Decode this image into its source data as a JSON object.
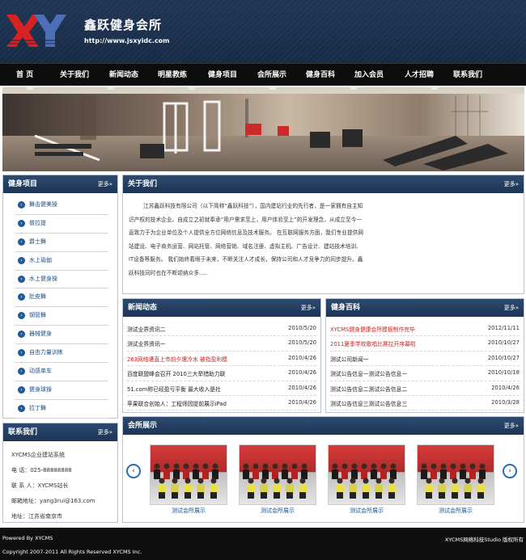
{
  "header": {
    "logo_text": "XY",
    "site_name": "鑫跃健身会所",
    "site_url": "http://www.jsxyidc.com"
  },
  "nav": [
    "首 页",
    "关于我们",
    "新闻动态",
    "明星教练",
    "健身项目",
    "会所展示",
    "健身百科",
    "加入会员",
    "人才招聘",
    "联系我们"
  ],
  "more_label": "更多",
  "projects": {
    "title": "健身项目",
    "items": [
      "舞击健美操",
      "普拉提",
      "爵士舞",
      "水上瑜伽",
      "水上健身操",
      "肚皮舞",
      "钢管舞",
      "器械健身",
      "自由力量训练",
      "动感单车",
      "健身球操",
      "拉丁舞"
    ]
  },
  "contact": {
    "title": "联系我们",
    "lines": [
      "XYCMS企业建站系统",
      "电 话：025-88888888",
      "联 系 人：XYCMS站长",
      "邮箱地址：yang3rui@163.com",
      "地址：江苏省南京市"
    ]
  },
  "about": {
    "title": "关于我们",
    "text": "江苏鑫跃科技有限公司（以下简称“鑫跃科技”），国内建站行业的先行者，是一家拥有自主知识产权的技术企业。自成立之初就奉承“用户需求至上，用户体验至上”的开发理念，从成立至今一直致力于为企业单位及个人提供全方位网络信息及技术服务。 在互联网服务方面，我们专业提供网站建设、电子商务运营、网站托管、网络营销、域名注册、虚拟主机、广告设计、建站技术培训、IT设备等服务。 我们始终着眼于未来，不断关注人才成长，保持公司和人才竞争力的同步提升。鑫跃科技同时也在不断颂纳众多....."
  },
  "news": {
    "title": "新闻动态",
    "items": [
      {
        "title": "测试业界资讯二",
        "date": "2010/5/20",
        "highlight": false
      },
      {
        "title": "测试业界资讯一",
        "date": "2010/5/20",
        "highlight": false
      },
      {
        "title": "263网络遭直上市前夕遭冷水 被指盈利模",
        "date": "2010/4/26",
        "highlight": true
      },
      {
        "title": "百度联盟峰会召开 2010三大举措助力联",
        "date": "2010/4/26",
        "highlight": false
      },
      {
        "title": "51.com称已经盈亏平衡 最大收入是社",
        "date": "2010/4/26",
        "highlight": false
      },
      {
        "title": "苹果联合创始人：工程师因提前展示iPad",
        "date": "2010/4/26",
        "highlight": false
      }
    ]
  },
  "wiki": {
    "title": "健身百科",
    "items": [
      {
        "title": "XYCMS健身健康会所模板制作完毕",
        "date": "2012/11/11",
        "highlight": true
      },
      {
        "title": "2011夏季学校歌唱比赛拉开序幕啦",
        "date": "2010/10/27",
        "highlight": true
      },
      {
        "title": "测试公司新闻一",
        "date": "2010/10/27",
        "highlight": false
      },
      {
        "title": "测试公告信息一测试公告信息一",
        "date": "2010/10/18",
        "highlight": false
      },
      {
        "title": "测试公告信息二测试公告信息二",
        "date": "2010/4/26",
        "highlight": false
      },
      {
        "title": "测试公告信息三测试公告信息三",
        "date": "2010/3/28",
        "highlight": false
      }
    ]
  },
  "showcase": {
    "title": "会所展示",
    "items": [
      "测试会所展示",
      "测试会所展示",
      "测试会所展示",
      "测试会所展示"
    ]
  },
  "footer": {
    "powered": "Powered By XYCMS",
    "copyright": "Copyright 2007-2011 All Rights Reserved XYCMS Inc.",
    "studio": "XYCMS网络科技Studio 版权所有"
  },
  "colors": {
    "highlight": "#cc2222",
    "link": "#1e4f87",
    "header_bg": "#1a2f4c",
    "panel_head": "#243f63",
    "logo_red": "#d62222",
    "logo_blue": "#4c6fb8"
  }
}
